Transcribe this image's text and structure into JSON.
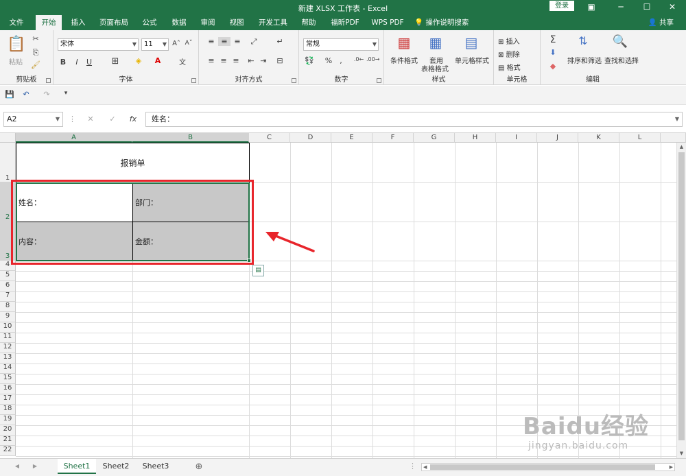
{
  "window": {
    "title": "新建 XLSX 工作表  -  Excel",
    "login": "登录"
  },
  "menu": {
    "tabs": [
      "文件",
      "开始",
      "插入",
      "页面布局",
      "公式",
      "数据",
      "审阅",
      "视图",
      "开发工具",
      "帮助",
      "福昕PDF",
      "WPS PDF"
    ],
    "search": "操作说明搜索",
    "share": "共享"
  },
  "ribbon": {
    "clipboard": {
      "paste": "粘贴",
      "label": "剪贴板"
    },
    "font": {
      "name": "宋体",
      "size": "11",
      "label": "字体",
      "bold": "B",
      "italic": "I",
      "underline": "U"
    },
    "alignment": {
      "label": "对齐方式"
    },
    "number": {
      "format": "常规",
      "label": "数字",
      "percent": "%"
    },
    "styles": {
      "conditional": "条件格式",
      "table1": "套用",
      "table2": "表格格式",
      "cell": "单元格样式",
      "label": "样式"
    },
    "cells": {
      "insert": "插入",
      "delete": "删除",
      "format": "格式",
      "label": "单元格"
    },
    "editing": {
      "sort": "排序和筛选",
      "find": "查找和选择",
      "label": "编辑"
    }
  },
  "formula_bar": {
    "name_box": "A2",
    "fx": "fx",
    "content": "姓名："
  },
  "grid": {
    "columns": [
      "A",
      "B",
      "C",
      "D",
      "E",
      "F",
      "G",
      "H",
      "I",
      "J",
      "K",
      "L"
    ],
    "rows": [
      "1",
      "2",
      "3",
      "4",
      "5",
      "6",
      "7",
      "8",
      "9",
      "10",
      "11",
      "12",
      "13",
      "14",
      "15",
      "16",
      "17",
      "18",
      "19",
      "20",
      "21",
      "22"
    ],
    "cells": {
      "title": "报销单",
      "name": "姓名：",
      "dept": "部门：",
      "content": "内容：",
      "amount": "金额："
    }
  },
  "sheets": [
    "Sheet1",
    "Sheet2",
    "Sheet3"
  ],
  "watermark": {
    "logo": "Baidu经验",
    "url": "jingyan.baidu.com"
  },
  "colors": {
    "accent": "#217346",
    "highlight": "#e8252b",
    "selection_fill": "#c8c8c8"
  }
}
